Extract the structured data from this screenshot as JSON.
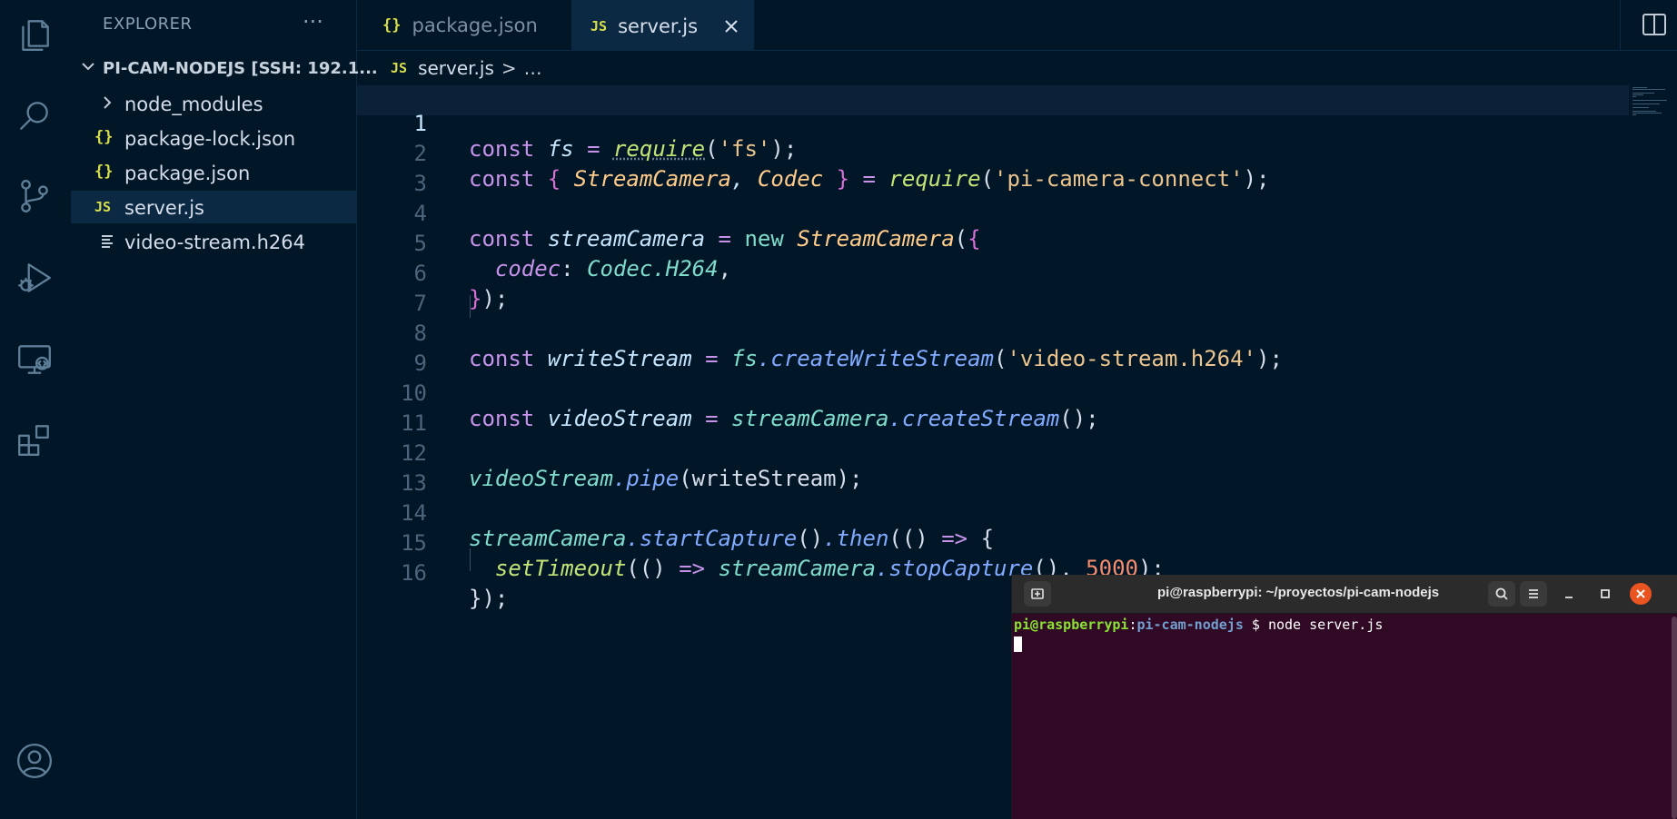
{
  "sidebar": {
    "title": "EXPLORER",
    "more": "···",
    "root": "PI-CAM-NODEJS [SSH: 192.1...",
    "items": [
      {
        "icon": "folder",
        "name": "node_modules"
      },
      {
        "icon": "{}",
        "name": "package-lock.json"
      },
      {
        "icon": "{}",
        "name": "package.json"
      },
      {
        "icon": "JS",
        "name": "server.js"
      },
      {
        "icon": "file",
        "name": "video-stream.h264"
      }
    ]
  },
  "tabs": [
    {
      "icon": "{}",
      "label": "package.json"
    },
    {
      "icon": "JS",
      "label": "server.js"
    }
  ],
  "breadcrumb": {
    "icon": "JS",
    "file": "server.js",
    "sep": ">",
    "more": "…"
  },
  "editor": {
    "line_numbers": [
      "1",
      "2",
      "3",
      "4",
      "5",
      "6",
      "7",
      "8",
      "9",
      "10",
      "11",
      "12",
      "13",
      "14",
      "15",
      "16"
    ],
    "lines": [
      "const fs = require('fs');",
      "const { StreamCamera, Codec } = require('pi-camera-connect');",
      "",
      "const streamCamera = new StreamCamera({",
      "  codec: Codec.H264,",
      "});",
      "",
      "const writeStream = fs.createWriteStream('video-stream.h264');",
      "",
      "const videoStream = streamCamera.createStream();",
      "",
      "videoStream.pipe(writeStream);",
      "",
      "streamCamera.startCapture().then(() => {",
      "  setTimeout(() => streamCamera.stopCapture(), 5000);",
      "});"
    ]
  },
  "terminal": {
    "title": "pi@raspberrypi: ~/proyectos/pi-cam-nodejs",
    "prompt_user": "pi@raspberrypi",
    "prompt_sep": ":",
    "prompt_path": "pi-cam-nodejs",
    "prompt_symbol": " $ ",
    "command": "node server.js"
  },
  "colors": {
    "background": "#011627",
    "keyword": "#c792ea",
    "string": "#ecc48d",
    "function": "#c5e478",
    "number": "#f78c6c",
    "terminal_bg": "#300a24",
    "terminal_close": "#e95420"
  }
}
